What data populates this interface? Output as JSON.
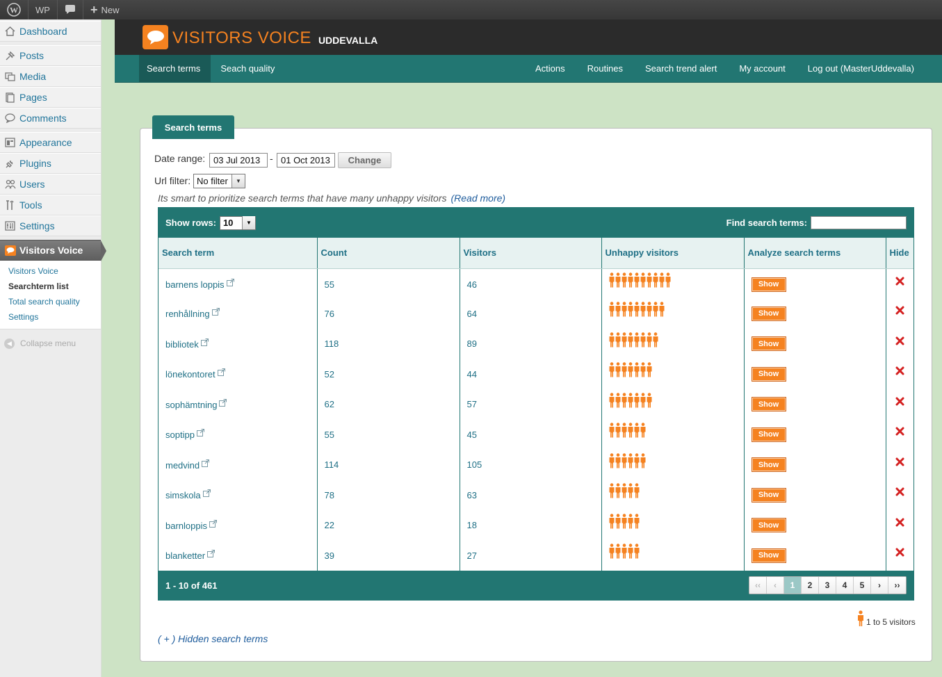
{
  "adminbar": {
    "site_label": "WP",
    "new_label": "New"
  },
  "sidebar": {
    "items": [
      {
        "label": "Dashboard",
        "icon": "house-icon"
      },
      {
        "label": "Posts",
        "icon": "pin-icon"
      },
      {
        "label": "Media",
        "icon": "media-icon"
      },
      {
        "label": "Pages",
        "icon": "pages-icon"
      },
      {
        "label": "Comments",
        "icon": "comment-icon"
      },
      {
        "label": "Appearance",
        "icon": "appearance-icon"
      },
      {
        "label": "Plugins",
        "icon": "plug-icon"
      },
      {
        "label": "Users",
        "icon": "users-icon"
      },
      {
        "label": "Tools",
        "icon": "tools-icon"
      },
      {
        "label": "Settings",
        "icon": "settings-icon"
      },
      {
        "label": "Visitors Voice",
        "icon": "speech-bubble-icon"
      }
    ],
    "submenu": [
      "Visitors Voice",
      "Searchterm list",
      "Total search quality",
      "Settings"
    ],
    "collapse_label": "Collapse menu"
  },
  "header": {
    "brand": "VISITORS VOICE",
    "city": "UDDEVALLA"
  },
  "nav": {
    "left": [
      "Search terms",
      "Seach quality"
    ],
    "right": [
      "Actions",
      "Routines",
      "Search trend alert",
      "My account",
      "Log out (MasterUddevalla)"
    ]
  },
  "panel": {
    "tab_title": "Search terms",
    "date_range_label": "Date range:",
    "date_from": "03 Jul 2013",
    "date_sep": "-",
    "date_to": "01 Oct 2013",
    "change_label": "Change",
    "url_filter_label": "Url filter:",
    "url_filter_value": "No filter",
    "hint_text": "Its smart to prioritize search terms that have many unhappy visitors",
    "read_more": "(Read more)"
  },
  "table": {
    "show_rows_label": "Show rows:",
    "show_rows_value": "10",
    "find_label": "Find search terms:",
    "headers": [
      "Search term",
      "Count",
      "Visitors",
      "Unhappy visitors",
      "Analyze search terms",
      "Hide"
    ],
    "show_label": "Show",
    "rows": [
      {
        "term": "barnens loppis",
        "count": "55",
        "visitors": "46",
        "unhappy_icons": 10
      },
      {
        "term": "renhållning",
        "count": "76",
        "visitors": "64",
        "unhappy_icons": 9
      },
      {
        "term": "bibliotek",
        "count": "118",
        "visitors": "89",
        "unhappy_icons": 8
      },
      {
        "term": "lönekontoret",
        "count": "52",
        "visitors": "44",
        "unhappy_icons": 7
      },
      {
        "term": "sophämtning",
        "count": "62",
        "visitors": "57",
        "unhappy_icons": 7
      },
      {
        "term": "soptipp",
        "count": "55",
        "visitors": "45",
        "unhappy_icons": 6
      },
      {
        "term": "medvind",
        "count": "114",
        "visitors": "105",
        "unhappy_icons": 6
      },
      {
        "term": "simskola",
        "count": "78",
        "visitors": "63",
        "unhappy_icons": 5
      },
      {
        "term": "barnloppis",
        "count": "22",
        "visitors": "18",
        "unhappy_icons": 5
      },
      {
        "term": "blanketter",
        "count": "39",
        "visitors": "27",
        "unhappy_icons": 5
      }
    ],
    "range_text": "1 - 10 of 461",
    "pager": [
      "‹‹",
      "‹",
      "1",
      "2",
      "3",
      "4",
      "5",
      "›",
      "››"
    ],
    "current_page": "1"
  },
  "legend_text": "1 to 5 visitors",
  "hidden_terms_link": "( + ) Hidden search terms",
  "colors": {
    "teal": "#227672",
    "orange": "#f58220",
    "background": "#cde3c5"
  }
}
